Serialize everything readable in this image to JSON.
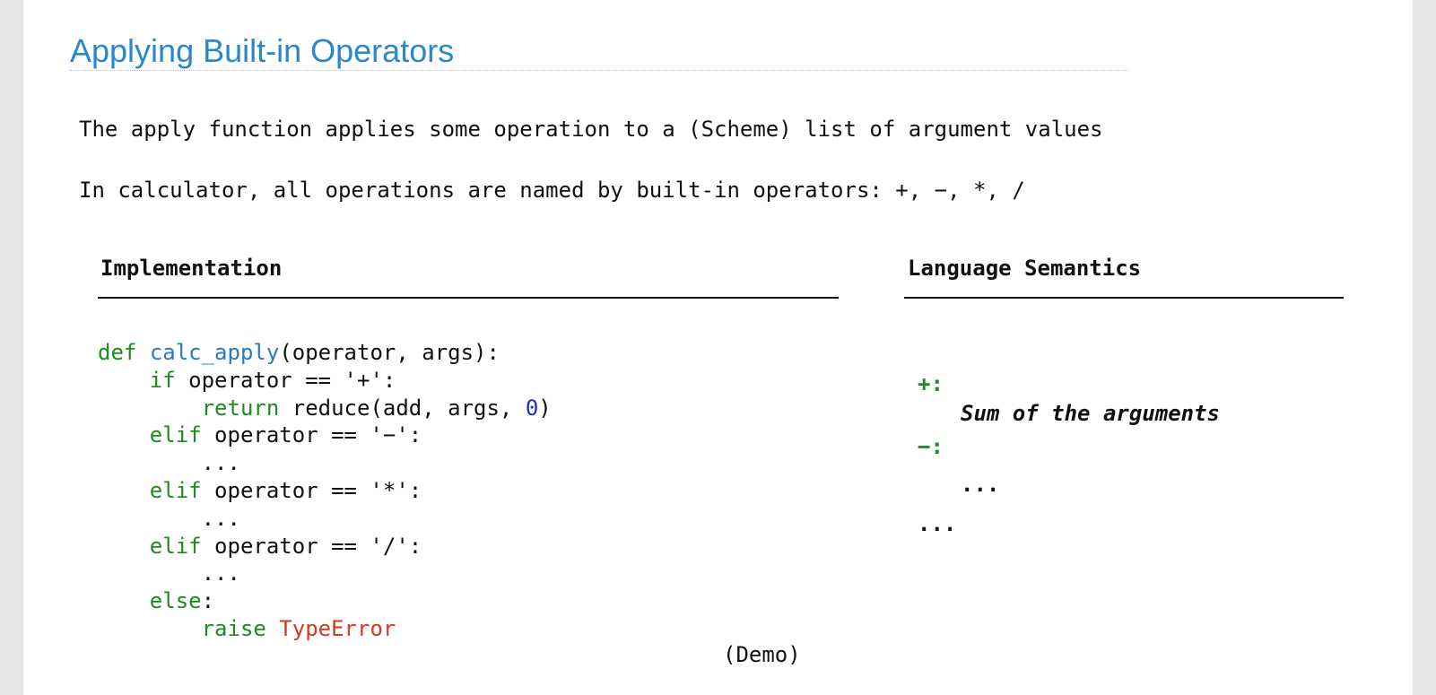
{
  "slide": {
    "title": "Applying Built-in Operators",
    "intro_line_1": "The apply function applies some operation to a (Scheme) list of argument values",
    "intro_line_2": "In calculator, all operations are named by built-in operators: +, −, *, /"
  },
  "implementation": {
    "heading": "Implementation",
    "code": {
      "l1_kw": "def",
      "l1_fn": "calc_apply",
      "l1_rest": "(operator, args):",
      "l2_kw": "if",
      "l2_rest": " operator == '+':",
      "l3_kw": "return",
      "l3_mid": " reduce(add, args, ",
      "l3_num": "0",
      "l3_end": ")",
      "l4_kw": "elif",
      "l4_rest": " operator == '−':",
      "l5": "...",
      "l6_kw": "elif",
      "l6_rest": " operator == '*':",
      "l7": "...",
      "l8_kw": "elif",
      "l8_rest": " operator == '/':",
      "l9": "...",
      "l10_kw": "else",
      "l10_rest": ":",
      "l11_kw": "raise",
      "l11_err": "TypeError"
    }
  },
  "semantics": {
    "heading": "Language Semantics",
    "plus_op": "+:",
    "plus_desc": "Sum of the arguments",
    "minus_op": "−:",
    "minus_desc": "...",
    "more": "..."
  },
  "footer": {
    "demo": "(Demo)"
  },
  "colors": {
    "title": "#2a88c9",
    "keyword": "#1f8a1f",
    "function_name": "#2a7ac0",
    "number": "#1a2fd0",
    "error_class": "#d23b1e"
  }
}
